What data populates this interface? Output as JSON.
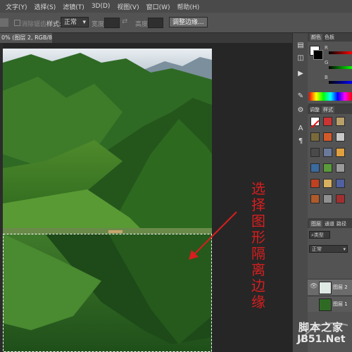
{
  "menu": [
    "文字(Y)",
    "选择(S)",
    "滤镜(T)",
    "3D(D)",
    "视图(V)",
    "窗口(W)",
    "帮助(H)"
  ],
  "options": {
    "antialias_label": "消除锯齿",
    "style_label": "样式:",
    "style_value": "正常",
    "width_label": "宽度:",
    "height_label": "高度:",
    "refine_button": "调整边缘..."
  },
  "document_tab": "0% (图层 2, RGB/8#) *",
  "annotation": [
    "选",
    "择",
    "图",
    "形",
    "隔",
    "离",
    "边",
    "缘"
  ],
  "panels": {
    "color_tabs": [
      "颜色",
      "色板"
    ],
    "channels": [
      "R",
      "G",
      "B"
    ],
    "adjust_tabs": [
      "调整",
      "样式"
    ],
    "layers_tabs": [
      "图层",
      "通道",
      "路径"
    ],
    "layers_kind": "类型",
    "blend_mode": "正常",
    "layer_names": [
      "图层 2",
      "图层 1"
    ]
  },
  "watermark": {
    "line1": "脚本之家",
    "line2": "JB51.Net"
  },
  "colors": {
    "annotation": "#d81e1e",
    "selection": "#ffffff"
  }
}
